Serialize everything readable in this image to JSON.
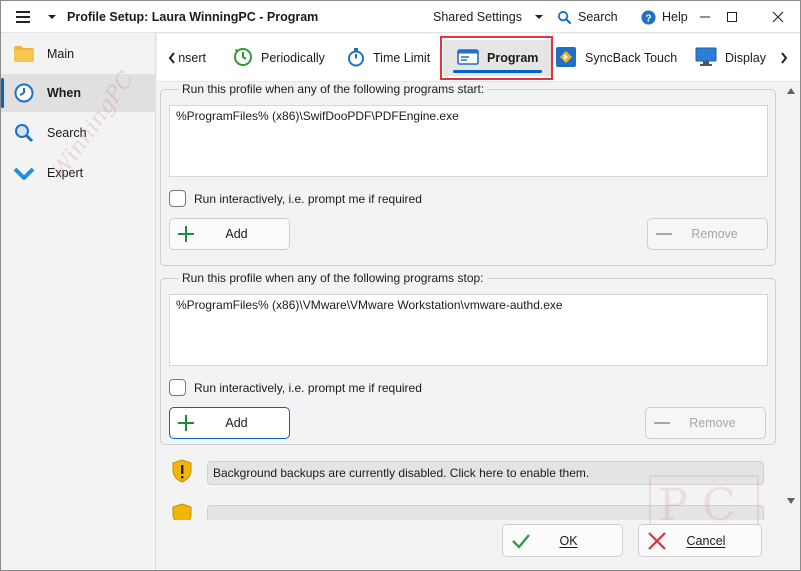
{
  "window": {
    "title": "Profile Setup: Laura WinningPC - Program",
    "shared_settings": "Shared Settings",
    "search": "Search",
    "help": "Help"
  },
  "sidebar": {
    "items": [
      {
        "label": "Main",
        "icon": "folder-icon"
      },
      {
        "label": "When",
        "icon": "clock-icon",
        "active": true
      },
      {
        "label": "Search",
        "icon": "magnifier-icon"
      },
      {
        "label": "Expert",
        "icon": "chevron-check-icon"
      }
    ],
    "watermark": "WinningPC"
  },
  "tabs": {
    "items": [
      {
        "label": "Insert"
      },
      {
        "label": "Periodically"
      },
      {
        "label": "Time Limit"
      },
      {
        "label": "Program",
        "active": true
      },
      {
        "label": "SyncBack Touch"
      },
      {
        "label": "Display"
      }
    ],
    "highlight_color": "#e0343f"
  },
  "start_group": {
    "title": "Run this profile when any of the following programs start:",
    "programs": [
      "%ProgramFiles% (x86)\\SwifDooPDF\\PDFEngine.exe"
    ],
    "interactive_label": "Run interactively, i.e. prompt me if required",
    "add_label": "Add",
    "remove_label": "Remove"
  },
  "stop_group": {
    "title": "Run this profile when any of the following programs stop:",
    "programs": [
      "%ProgramFiles% (x86)\\VMware\\VMware Workstation\\vmware-authd.exe"
    ],
    "interactive_label": "Run interactively, i.e. prompt me if required",
    "add_label": "Add",
    "remove_label": "Remove"
  },
  "notice": {
    "text": "Background backups are currently disabled. Click here to enable them."
  },
  "footer": {
    "ok_label": "OK",
    "cancel_label": "Cancel"
  },
  "colors": {
    "accent": "#0067c0",
    "add_green": "#1e8a3a",
    "cancel_red": "#d8323c",
    "ok_green": "#2f9a47"
  }
}
